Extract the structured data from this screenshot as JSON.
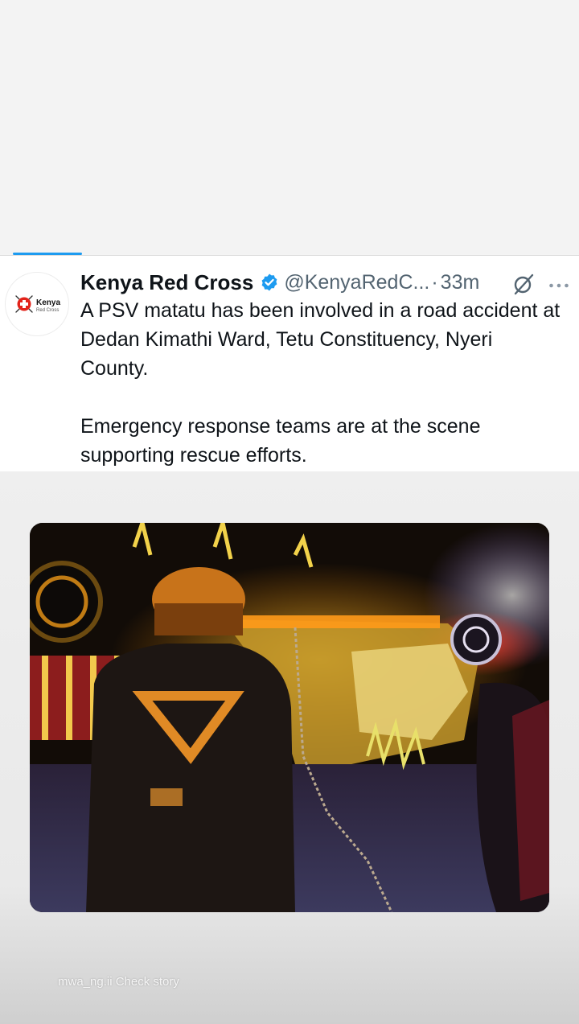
{
  "tweet": {
    "author_name": "Kenya Red Cross",
    "handle": "@KenyaRedC...",
    "separator": "·",
    "time_ago": "33m",
    "paragraphs": [
      "A PSV matatu has been involved in a road accident at Dedan Kimathi Ward, Tetu Constituency, Nyeri County.",
      "Emergency response teams are at the scene supporting rescue efforts."
    ],
    "avatar": {
      "line1": "Kenya",
      "line2": "Red Cross"
    },
    "media": "accident-scene-photo"
  },
  "story": {
    "caption": "mwa_ng.ii Check story"
  },
  "icons": {
    "verified": "verified-badge-icon",
    "grok": "grok-icon",
    "more": "more-options-icon"
  },
  "colors": {
    "verified": "#1d9bf0",
    "red_cross": "#e2231a",
    "text": "#0f1419",
    "secondary_text": "#536471"
  }
}
